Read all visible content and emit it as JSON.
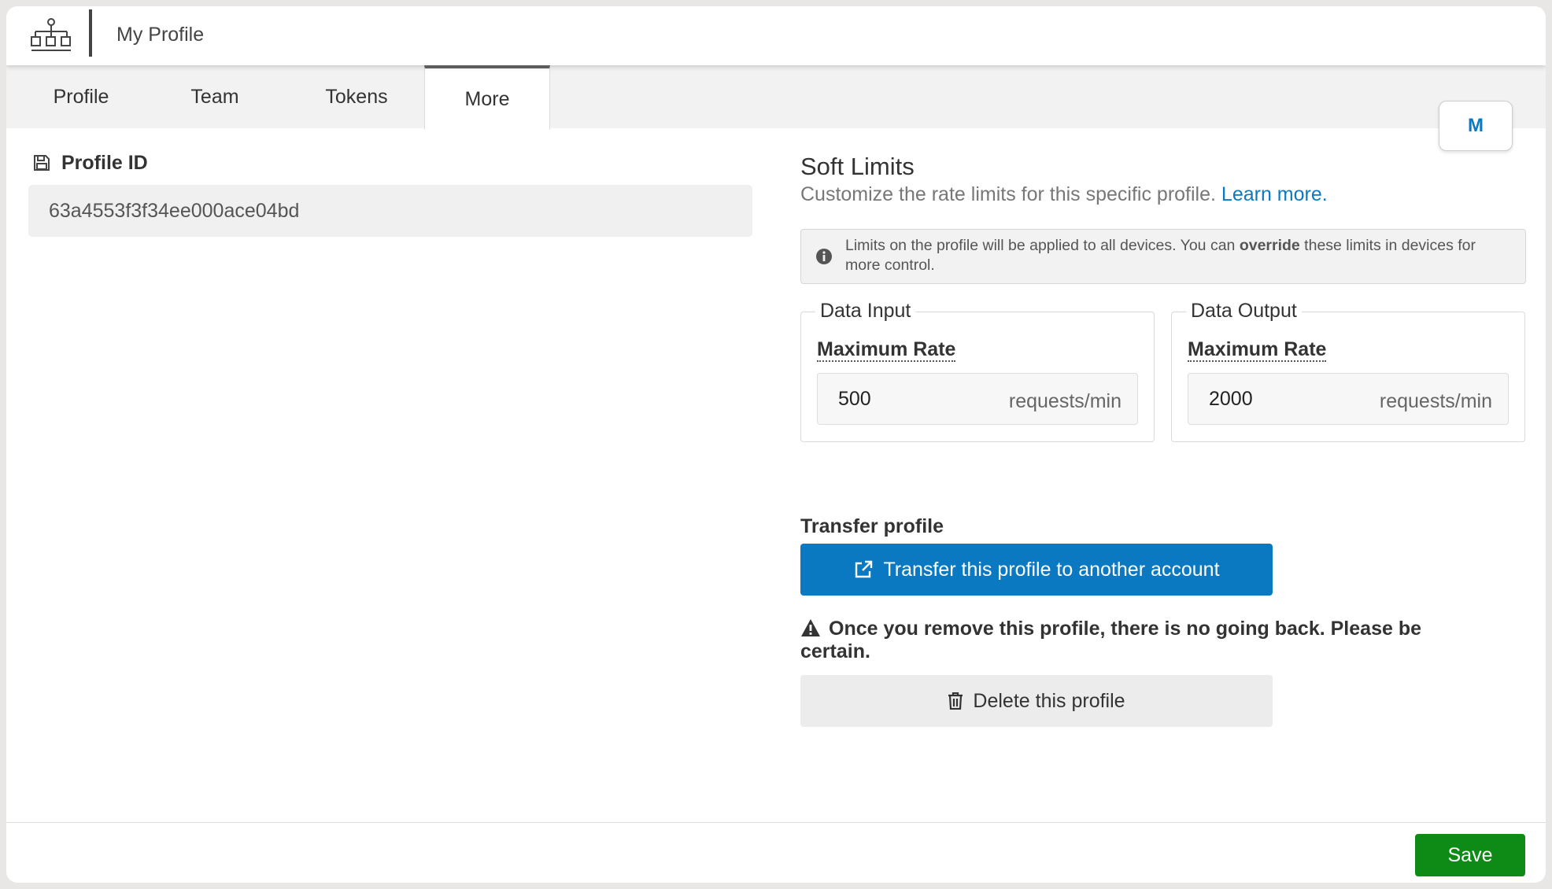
{
  "header": {
    "title": "My Profile",
    "logo_icon": "network-hierarchy-icon"
  },
  "tabs": [
    {
      "label": "Profile",
      "active": false
    },
    {
      "label": "Team",
      "active": false
    },
    {
      "label": "Tokens",
      "active": false
    },
    {
      "label": "More",
      "active": true
    }
  ],
  "avatar": {
    "initial": "M",
    "color": "#0b79c2"
  },
  "profile_id": {
    "label": "Profile ID",
    "icon": "save-icon",
    "value": "63a4553f3f34ee000ace04bd"
  },
  "soft_limits": {
    "title": "Soft Limits",
    "subtitle": "Customize the rate limits for this specific profile.",
    "learn_more": "Learn more.",
    "info": {
      "icon": "info-icon",
      "text_before": "Limits on the profile will be applied to all devices. You can ",
      "text_bold": "override",
      "text_after": " these limits in devices for more control."
    },
    "data_input": {
      "legend": "Data Input",
      "label": "Maximum Rate",
      "value": "500",
      "unit": "requests/min"
    },
    "data_output": {
      "legend": "Data Output",
      "label": "Maximum Rate",
      "value": "2000",
      "unit": "requests/min"
    }
  },
  "transfer": {
    "label": "Transfer profile",
    "button_label": "Transfer this profile to another account",
    "button_icon": "external-link-icon",
    "button_color": "#0b79c2"
  },
  "danger": {
    "warning_icon": "warning-triangle-icon",
    "warning_text": "Once you remove this profile, there is no going back. Please be certain.",
    "delete_label": "Delete this profile",
    "delete_icon": "trash-icon"
  },
  "footer": {
    "save_label": "Save",
    "save_color": "#0e8a16"
  }
}
